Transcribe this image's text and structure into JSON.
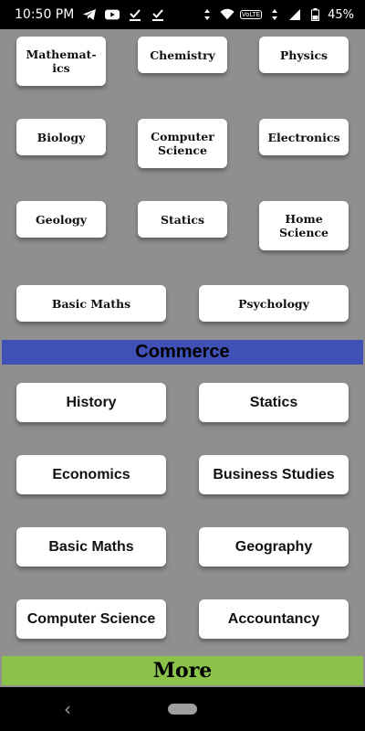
{
  "status_bar": {
    "time": "10:50 PM",
    "battery": "45%",
    "volte": "VoLTE"
  },
  "science": {
    "items": [
      "Mathemat-\nics",
      "Chemistry",
      "Physics",
      "Biology",
      "Computer\nScience",
      "Electronics",
      "Geology",
      "Statics",
      "Home\nScience",
      "Basic Maths",
      "Psychology"
    ]
  },
  "commerce": {
    "header": "Commerce",
    "items": [
      "History",
      "Statics",
      "Economics",
      "Business Studies",
      "Basic Maths",
      "Geography",
      "Computer Science",
      "Accountancy"
    ]
  },
  "more": {
    "header": "More"
  },
  "colors": {
    "commerce_band": "#3f51b5",
    "more_band": "#8bc34a",
    "background": "#8f8f8f"
  }
}
